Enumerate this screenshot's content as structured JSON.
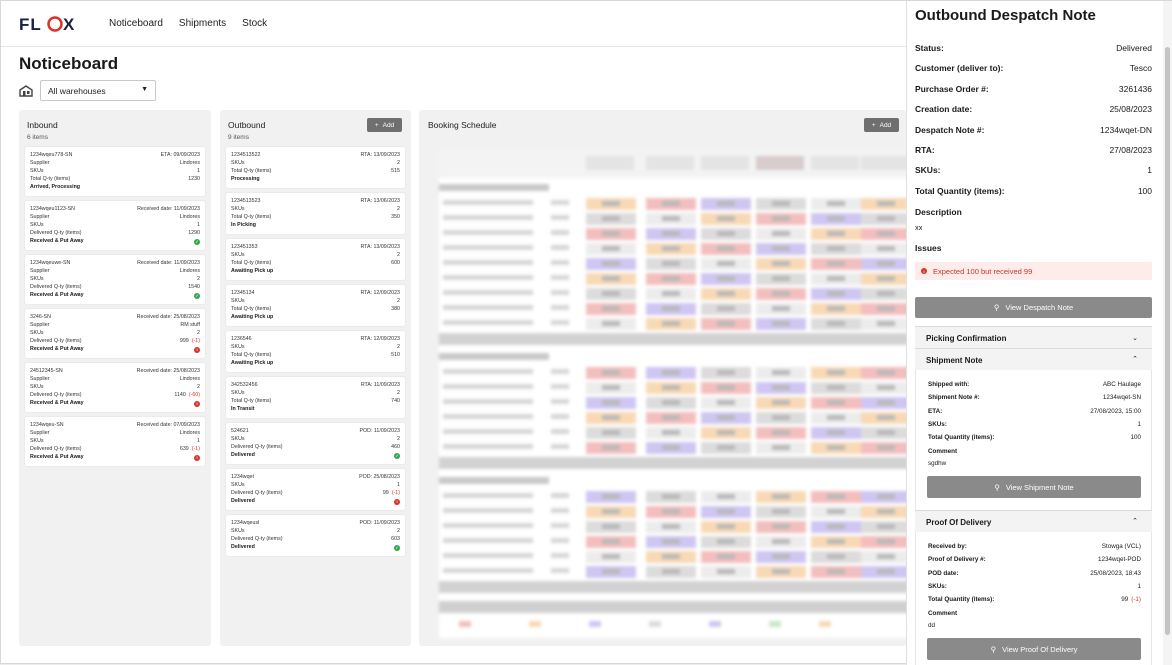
{
  "brand": {
    "logo_text": "FLOX",
    "accent": "#e0312b",
    "dark": "#16214a"
  },
  "nav": {
    "items": [
      "Noticeboard",
      "Shipments",
      "Stock"
    ]
  },
  "page": {
    "title": "Noticeboard",
    "warehouse_select": "All warehouses"
  },
  "add_label": "Add",
  "inbound": {
    "title": "Inbound",
    "count": "6 items",
    "cards": [
      {
        "id": "1234wqeu778-SN",
        "date": "ETA: 09/09/2023",
        "rows": [
          [
            "Supplier",
            "Lindores"
          ],
          [
            "SKUs",
            "1"
          ],
          [
            "Total Q-ty (items)",
            "1230"
          ]
        ],
        "status": "Arrived, Processing",
        "icon": "",
        "delta": ""
      },
      {
        "id": "1234wqeu1123-SN",
        "date": "Received date: 11/09/2023",
        "rows": [
          [
            "Supplier",
            "Lindores"
          ],
          [
            "SKUs",
            "1"
          ],
          [
            "Delivered Q-ty (items)",
            "1290"
          ]
        ],
        "status": "Received & Put Away",
        "icon": "ok",
        "delta": ""
      },
      {
        "id": "1234wqeuwe-SN",
        "date": "Received date: 11/09/2023",
        "rows": [
          [
            "Supplier",
            "Lindores"
          ],
          [
            "SKUs",
            "2"
          ],
          [
            "Delivered Q-ty (items)",
            "1540"
          ]
        ],
        "status": "Received & Put Away",
        "icon": "ok",
        "delta": ""
      },
      {
        "id": "3246-SN",
        "date": "Received date: 25/08/2023",
        "rows": [
          [
            "Supplier",
            "RM stuff"
          ],
          [
            "SKUs",
            "2"
          ],
          [
            "Delivered Q-ty (items)",
            "999"
          ]
        ],
        "status": "Received & Put Away",
        "icon": "err",
        "delta": "(-1)"
      },
      {
        "id": "24512345-SN",
        "date": "Received date: 25/08/2023",
        "rows": [
          [
            "Supplier",
            "Lindores"
          ],
          [
            "SKUs",
            "2"
          ],
          [
            "Delivered Q-ty (items)",
            "1140"
          ]
        ],
        "status": "Received & Put Away",
        "icon": "err",
        "delta": "(-60)"
      },
      {
        "id": "1234wqeu-SN",
        "date": "Received date: 07/09/2023",
        "rows": [
          [
            "Supplier",
            "Lindores"
          ],
          [
            "SKUs",
            "1"
          ],
          [
            "Delivered Q-ty (items)",
            "639"
          ]
        ],
        "status": "Received & Put Away",
        "icon": "err",
        "delta": "(-1)"
      }
    ]
  },
  "outbound": {
    "title": "Outbound",
    "count": "9 items",
    "cards": [
      {
        "id": "1234513522",
        "date": "RTA: 13/09/2023",
        "rows": [
          [
            "SKUs",
            "2"
          ],
          [
            "Total Q-ty (items)",
            "515"
          ]
        ],
        "status": "Processing",
        "icon": "",
        "delta": ""
      },
      {
        "id": "1234513523",
        "date": "RTA: 13/06/2023",
        "rows": [
          [
            "SKUs",
            "2"
          ],
          [
            "Total Q-ty (items)",
            "350"
          ]
        ],
        "status": "In Picking",
        "icon": "",
        "delta": ""
      },
      {
        "id": "123451353",
        "date": "RTA: 13/09/2023",
        "rows": [
          [
            "SKUs",
            "2"
          ],
          [
            "Total Q-ty (items)",
            "600"
          ]
        ],
        "status": "Awaiting Pick up",
        "icon": "",
        "delta": ""
      },
      {
        "id": "12345134",
        "date": "RTA: 12/09/2023",
        "rows": [
          [
            "SKUs",
            "2"
          ],
          [
            "Total Q-ty (items)",
            "380"
          ]
        ],
        "status": "Awaiting Pick up",
        "icon": "",
        "delta": ""
      },
      {
        "id": "1236546",
        "date": "RTA: 12/09/2023",
        "rows": [
          [
            "SKUs",
            "2"
          ],
          [
            "Total Q-ty (items)",
            "510"
          ]
        ],
        "status": "Awaiting Pick up",
        "icon": "",
        "delta": ""
      },
      {
        "id": "342532456",
        "date": "RTA: 11/09/2023",
        "rows": [
          [
            "SKUs",
            "2"
          ],
          [
            "Total Q-ty (items)",
            "740"
          ]
        ],
        "status": "In Transit",
        "icon": "",
        "delta": ""
      },
      {
        "id": "524621",
        "date": "POD: 11/09/2023",
        "rows": [
          [
            "SKUs",
            "2"
          ],
          [
            "Delivered Q-ty (items)",
            "460"
          ]
        ],
        "status": "Delivered",
        "icon": "ok",
        "delta": ""
      },
      {
        "id": "1234wqet",
        "date": "POD: 25/08/2023",
        "rows": [
          [
            "SKUs",
            "1"
          ],
          [
            "Delivered Q-ty (items)",
            "99"
          ]
        ],
        "status": "Delivered",
        "icon": "err",
        "delta": "(-1)"
      },
      {
        "id": "1234wqeusl",
        "date": "POD: 11/09/2023",
        "rows": [
          [
            "SKUs",
            "2"
          ],
          [
            "Delivered Q-ty (items)",
            "603"
          ]
        ],
        "status": "Delivered",
        "icon": "ok",
        "delta": ""
      }
    ]
  },
  "booking": {
    "title": "Booking Schedule"
  },
  "detail": {
    "title": "Outbound Despatch Note",
    "rows": [
      [
        "Status:",
        "Delivered"
      ],
      [
        "Customer (deliver to):",
        "Tesco"
      ],
      [
        "Purchase Order #:",
        "3261436"
      ],
      [
        "Creation date:",
        "25/08/2023"
      ],
      [
        "Despatch Note #:",
        "1234wqet-DN"
      ],
      [
        "RTA:",
        "27/08/2023"
      ],
      [
        "SKUs:",
        "1"
      ],
      [
        "Total Quantity (items):",
        "100"
      ]
    ],
    "description_label": "Description",
    "description": "xx",
    "issues_label": "Issues",
    "issue_text": "Expected 100 but received 99",
    "view_despatch": "View Despatch Note",
    "picking_label": "Picking Confirmation",
    "shipment_label": "Shipment Note",
    "shipment_rows": [
      [
        "Shipped with:",
        "ABC Haulage"
      ],
      [
        "Shipment Note #:",
        "1234wqet-SN"
      ],
      [
        "ETA:",
        "27/08/2023, 15:00"
      ],
      [
        "SKUs:",
        "1"
      ],
      [
        "Total Quantity (items):",
        "100"
      ]
    ],
    "shipment_comment_label": "Comment",
    "shipment_comment": "sgdhw",
    "view_shipment": "View Shipment Note",
    "pod_label": "Proof Of Delivery",
    "pod_rows": [
      [
        "Received by:",
        "Stowga (VCL)"
      ],
      [
        "Proof of Delivery #:",
        "1234wqet-POD"
      ],
      [
        "POD date:",
        "25/08/2023, 18:43"
      ],
      [
        "SKUs:",
        "1"
      ],
      [
        "Total Quantity (items):",
        "99"
      ]
    ],
    "pod_delta": "(-1)",
    "pod_comment_label": "Comment",
    "pod_comment": "dd",
    "view_pod": "View Proof Of Delivery"
  }
}
